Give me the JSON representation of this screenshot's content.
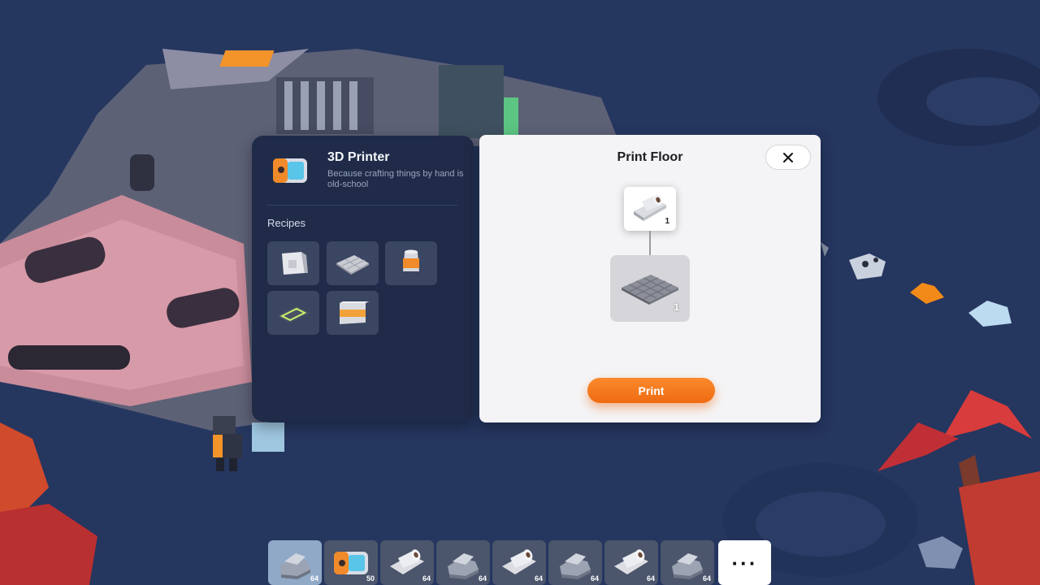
{
  "printer_panel": {
    "title": "3D Printer",
    "description": "Because crafting things by hand is old-school",
    "recipes_label": "Recipes",
    "recipes": [
      {
        "icon": "wall-panel-icon"
      },
      {
        "icon": "floor-tile-icon"
      },
      {
        "icon": "canister-icon"
      },
      {
        "icon": "light-strip-icon"
      },
      {
        "icon": "striped-wall-icon"
      }
    ]
  },
  "dialog": {
    "title": "Print Floor",
    "ingredient": {
      "icon": "material-roll-icon",
      "count": "1"
    },
    "result": {
      "icon": "floor-tile-icon",
      "count": "1"
    },
    "print_label": "Print"
  },
  "hotbar": {
    "slots": [
      {
        "icon": "rock-ore-icon",
        "count": "64",
        "selected": true
      },
      {
        "icon": "printer-icon",
        "count": "50"
      },
      {
        "icon": "material-roll-icon",
        "count": "64"
      },
      {
        "icon": "rock-ore-icon",
        "count": "64"
      },
      {
        "icon": "material-roll-icon",
        "count": "64"
      },
      {
        "icon": "rock-ore-icon",
        "count": "64"
      },
      {
        "icon": "material-roll-icon",
        "count": "64"
      },
      {
        "icon": "rock-ore-icon",
        "count": "64"
      }
    ],
    "more_label": "···"
  },
  "colors": {
    "accent": "#f47a1f",
    "panel_dark": "#1f2b48",
    "dialog_bg": "#f4f4f6",
    "background": "#25365f"
  }
}
